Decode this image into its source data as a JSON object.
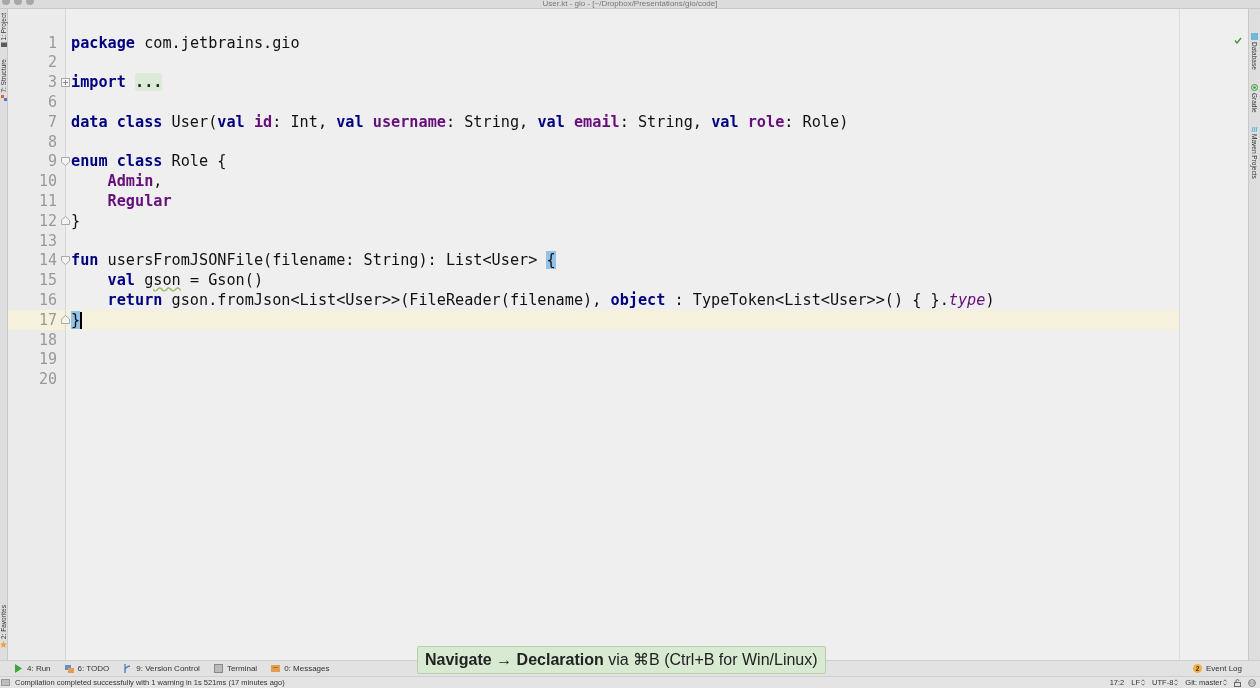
{
  "window": {
    "title": "User.kt - gio - [~/Dropbox/Presentations/gio/code]"
  },
  "left_tool_strip": [
    {
      "label": "1: Project"
    },
    {
      "label": "7: Structure"
    },
    {
      "label": "2: Favorites"
    }
  ],
  "right_tool_strip": [
    {
      "label": "Database"
    },
    {
      "label": "Gradle"
    },
    {
      "label": "Maven Projects"
    }
  ],
  "editor": {
    "lines": [
      {
        "number": "1",
        "tokens": [
          {
            "kind": "keyword",
            "text": "package"
          },
          {
            "kind": "plain",
            "text": " com.jetbrains.gio"
          }
        ]
      },
      {
        "number": "2"
      },
      {
        "number": "3",
        "collapsed": true,
        "tokens": [
          {
            "kind": "keyword",
            "text": "import "
          },
          {
            "kind": "folded",
            "text": "..."
          }
        ]
      },
      {
        "number": "6"
      },
      {
        "number": "7",
        "tokens": [
          {
            "kind": "keyword",
            "text": "data class"
          },
          {
            "kind": "plain",
            "text": " User("
          },
          {
            "kind": "keyword",
            "text": "val"
          },
          {
            "kind": "property",
            "text": " id"
          },
          {
            "kind": "plain",
            "text": ": Int, "
          },
          {
            "kind": "keyword",
            "text": "val"
          },
          {
            "kind": "property",
            "text": " username"
          },
          {
            "kind": "plain",
            "text": ": String, "
          },
          {
            "kind": "keyword",
            "text": "val"
          },
          {
            "kind": "property",
            "text": " email"
          },
          {
            "kind": "plain",
            "text": ": String, "
          },
          {
            "kind": "keyword",
            "text": "val"
          },
          {
            "kind": "property",
            "text": " role"
          },
          {
            "kind": "plain",
            "text": ": Role)"
          }
        ]
      },
      {
        "number": "8"
      },
      {
        "number": "9",
        "fold_start": true,
        "tokens": [
          {
            "kind": "keyword",
            "text": "enum class"
          },
          {
            "kind": "plain",
            "text": " Role {"
          }
        ]
      },
      {
        "number": "10",
        "tokens": [
          {
            "kind": "property",
            "text": "    Admin"
          },
          {
            "kind": "plain",
            "text": ","
          }
        ]
      },
      {
        "number": "11",
        "tokens": [
          {
            "kind": "property",
            "text": "    Regular"
          }
        ]
      },
      {
        "number": "12",
        "fold_end": true,
        "tokens": [
          {
            "kind": "plain",
            "text": "}"
          }
        ]
      },
      {
        "number": "13"
      },
      {
        "number": "14",
        "fold_start": true,
        "tokens": [
          {
            "kind": "keyword",
            "text": "fun"
          },
          {
            "kind": "plain",
            "text": " usersFromJSONFile(filename: String): List<User> "
          },
          {
            "kind": "brace_match",
            "text": "{"
          }
        ]
      },
      {
        "number": "15",
        "tokens": [
          {
            "kind": "keyword",
            "text": "    val "
          },
          {
            "kind": "warning",
            "text": "gson"
          },
          {
            "kind": "plain",
            "text": " = Gson()"
          }
        ]
      },
      {
        "number": "16",
        "tokens": [
          {
            "kind": "keyword",
            "text": "    return"
          },
          {
            "kind": "plain",
            "text": " gson.fromJson<List<User>>(FileReader(filename), "
          },
          {
            "kind": "keyword",
            "text": "object"
          },
          {
            "kind": "plain",
            "text": " : TypeToken<List<User>>() { }."
          },
          {
            "kind": "italic",
            "text": "type"
          },
          {
            "kind": "plain",
            "text": ")"
          }
        ]
      },
      {
        "number": "17",
        "current": true,
        "fold_end": true,
        "tokens": [
          {
            "kind": "brace_match",
            "text": "}"
          }
        ]
      },
      {
        "number": "18"
      },
      {
        "number": "19"
      },
      {
        "number": "20"
      }
    ]
  },
  "tooltip": "**Navigate → Declaration** via ⌘B (Ctrl+B for Win/Linux)",
  "tool_windows": [
    {
      "label": "4: Run"
    },
    {
      "label": "6: TODO"
    },
    {
      "label": "9: Version Control"
    },
    {
      "label": "Terminal"
    },
    {
      "label": "0: Messages"
    }
  ],
  "event_log": {
    "badge": "2",
    "label": "Event Log"
  },
  "status_bar": {
    "message": "Compilation completed successfully with 1 warning in 1s 521ms (17 minutes ago)",
    "position": "17:2",
    "line_separator": "LF",
    "encoding": "UTF-8",
    "branch": "Git: master"
  }
}
